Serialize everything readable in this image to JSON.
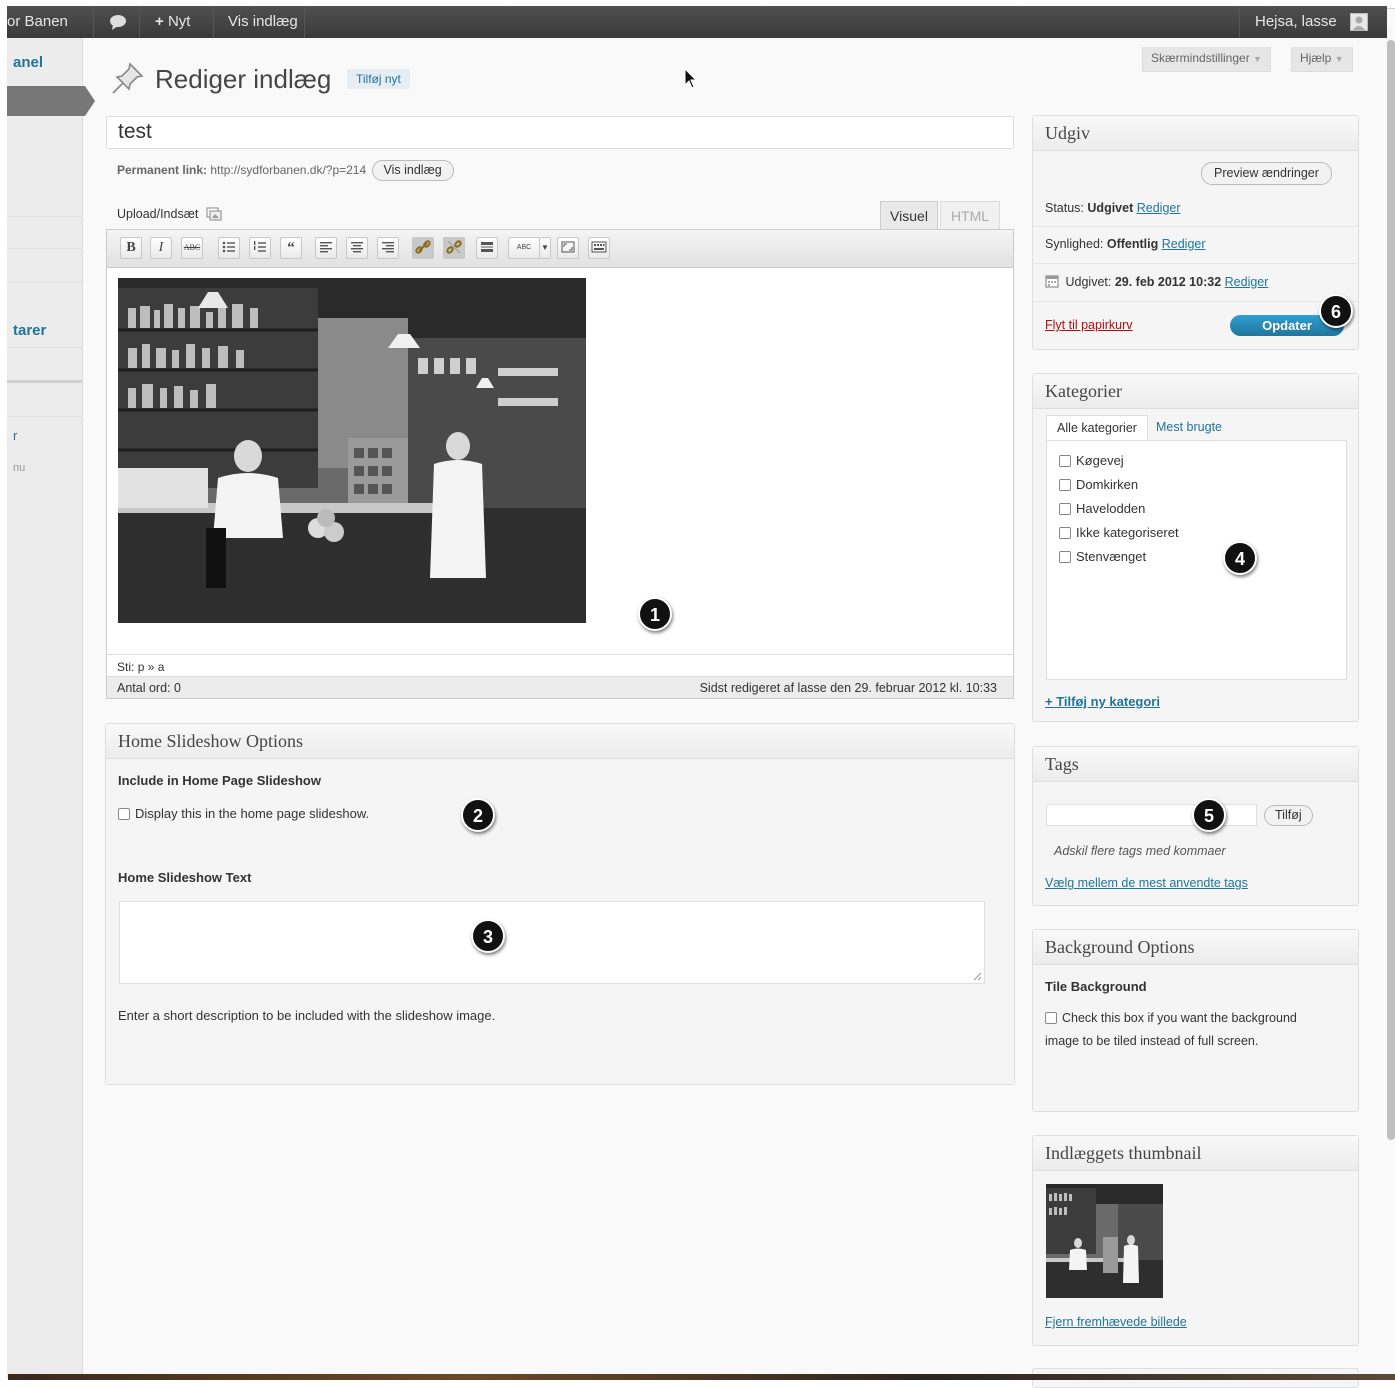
{
  "adminbar": {
    "site": "or Banen",
    "new": "Nyt",
    "view": "Vis indlæg",
    "greeting": "Hejsa, lasse"
  },
  "leftmenu": {
    "item1": "anel",
    "item2": "tarer",
    "item3": "r",
    "item4": "nu"
  },
  "header": {
    "title": "Rediger indlæg",
    "add_new": "Tilføj nyt",
    "screen_options": "Skærmindstillinger",
    "help": "Hjælp"
  },
  "post": {
    "title": "test",
    "permalink_label": "Permanent link:",
    "permalink_url": "http://sydforbanen.dk/?p=214",
    "view_button": "Vis indlæg"
  },
  "editor": {
    "upload_label": "Upload/Indsæt",
    "tab_visual": "Visuel",
    "tab_html": "HTML",
    "path_label": "Sti:",
    "path_value": "p » a",
    "word_count": "Antal ord: 0",
    "last_edited": "Sidst redigeret af lasse den 29. februar 2012 kl. 10:33",
    "toolbar_icons": [
      "bold-icon",
      "italic-icon",
      "strikethrough-icon",
      "bullet-list-icon",
      "numbered-list-icon",
      "blockquote-icon",
      "align-left-icon",
      "align-center-icon",
      "align-right-icon",
      "link-icon",
      "unlink-icon",
      "more-tag-icon",
      "spellcheck-icon",
      "dropdown-icon",
      "fullscreen-icon",
      "kitchen-sink-icon"
    ]
  },
  "slideshow": {
    "title": "Home Slideshow Options",
    "include_heading": "Include in Home Page Slideshow",
    "checkbox_label": "Display this in the home page slideshow.",
    "text_heading": "Home Slideshow Text",
    "description": "Enter a short description to be included with the slideshow image."
  },
  "publish": {
    "title": "Udgiv",
    "preview": "Preview ændringer",
    "status_label": "Status:",
    "status_value": "Udgivet",
    "visibility_label": "Synlighed:",
    "visibility_value": "Offentlig",
    "published_label": "Udgivet:",
    "published_value": "29. feb 2012 10:32",
    "edit": "Rediger",
    "trash": "Flyt til papirkurv",
    "update": "Opdater"
  },
  "categories": {
    "title": "Kategorier",
    "tab_all": "Alle kategorier",
    "tab_most": "Mest brugte",
    "items": [
      "Køgevej",
      "Domkirken",
      "Havelodden",
      "Ikke kategoriseret",
      "Stenvænget"
    ],
    "add_new": "+ Tilføj ny kategori"
  },
  "tags": {
    "title": "Tags",
    "add_button": "Tilføj",
    "hint": "Adskil flere tags med kommaer",
    "choose": "Vælg mellem de mest anvendte tags"
  },
  "background": {
    "title": "Background Options",
    "heading": "Tile Background",
    "line1": "Check this box if you want the background",
    "line2": "image to be tiled instead of full screen."
  },
  "thumbnail": {
    "title": "Indlæggets thumbnail",
    "remove": "Fjern fremhævede billede"
  },
  "callouts": [
    "1",
    "2",
    "3",
    "4",
    "5",
    "6"
  ],
  "colors": {
    "link": "#21759b",
    "adminbar": "#464646",
    "trash": "#bc0b0b",
    "update_button": "#21759b"
  }
}
